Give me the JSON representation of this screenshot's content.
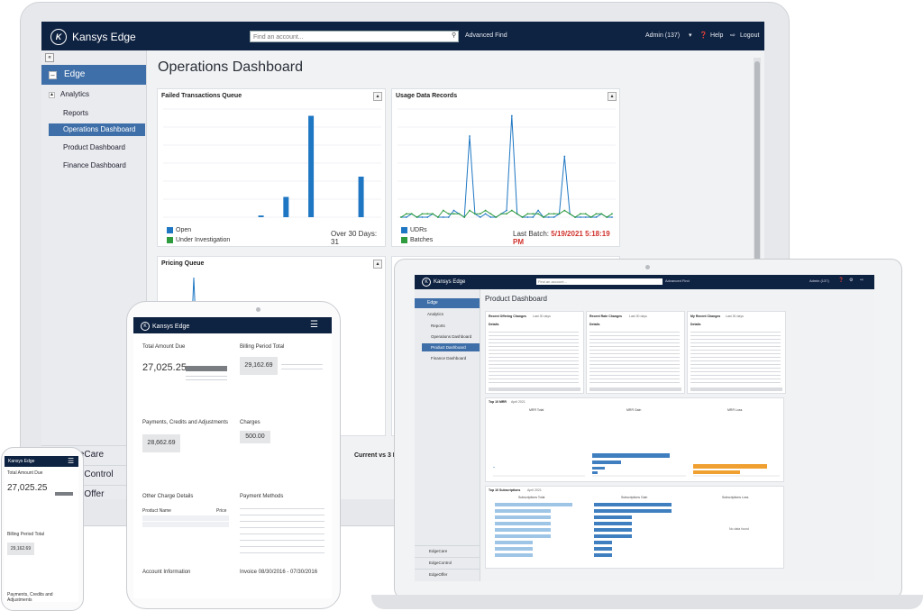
{
  "colors": {
    "navy": "#0e2241",
    "accent": "#3f6fa8",
    "bar_blue": "#1f77c3",
    "green": "#2e9b3f",
    "red": "#d0302a",
    "orange": "#f0a030",
    "light_blue": "#9ec5e6"
  },
  "desktop": {
    "brand": "Kansys Edge",
    "search_placeholder": "Find an account...",
    "advanced_find": "Advanced Find",
    "user": "Admin (137)",
    "help": "Help",
    "logout": "Logout",
    "sidebar": {
      "edge": "Edge",
      "analytics": "Analytics",
      "items": [
        "Reports",
        "Operations Dashboard",
        "Product Dashboard",
        "Finance Dashboard"
      ],
      "bottom": [
        "EdgeCare",
        "EdgeControl",
        "EdgeOffer"
      ]
    },
    "page_title": "Operations Dashboard",
    "panels": {
      "failed": {
        "title": "Failed Transactions Queue",
        "legend": [
          "Open",
          "Under Investigation"
        ],
        "summary": "Over 30 Days: 31"
      },
      "usage": {
        "title": "Usage Data Records",
        "legend": [
          "UDRs",
          "Batches"
        ],
        "last_batch_label": "Last Batch:",
        "last_batch_value": "5/19/2021  5:18:19 PM"
      },
      "pricing": {
        "title": "Pricing Queue"
      },
      "current": {
        "title": "Current vs 3 Mo"
      }
    }
  },
  "chart_data": [
    {
      "type": "bar",
      "title": "Failed Transactions Queue",
      "series": [
        {
          "name": "Open",
          "values": [
            0,
            0,
            0,
            0.5,
            6,
            30,
            0,
            12
          ]
        }
      ]
    },
    {
      "type": "line",
      "title": "Usage Data Records",
      "series": [
        {
          "name": "UDRs",
          "values": [
            0,
            0,
            1,
            0,
            0,
            0,
            1,
            0,
            0,
            0,
            2,
            1,
            0,
            24,
            1,
            0,
            1,
            0,
            0,
            1,
            2,
            30,
            1,
            0,
            0,
            0,
            2,
            0,
            0,
            0,
            1,
            18,
            1,
            0,
            0,
            0,
            0,
            0,
            1,
            0,
            0
          ]
        },
        {
          "name": "Batches",
          "values": [
            0,
            1,
            1,
            0,
            1,
            1,
            1,
            0,
            2,
            1,
            1,
            1,
            0,
            2,
            1,
            1,
            2,
            1,
            0,
            1,
            1,
            2,
            1,
            0,
            1,
            1,
            1,
            0,
            1,
            1,
            1,
            2,
            1,
            0,
            1,
            1,
            0,
            1,
            1,
            0,
            1
          ]
        }
      ]
    }
  ],
  "laptop": {
    "brand": "Kansys Edge",
    "search_placeholder": "Find an account...",
    "advanced_find": "Advanced Find",
    "user": "Admin (137)",
    "sidebar": {
      "edge": "Edge",
      "analytics": "Analytics",
      "items": [
        "Reports",
        "Operations Dashboard",
        "Product Dashboard",
        "Finance Dashboard"
      ],
      "bottom": [
        "EdgeCare",
        "EdgeControl",
        "EdgeOffer"
      ]
    },
    "page_title": "Product Dashboard",
    "cards": [
      {
        "title": "Recent Offering Changes",
        "sub": "Last 30 days",
        "details": "Details"
      },
      {
        "title": "Recent Rate Changes",
        "sub": "Last 30 days",
        "details": "Details"
      },
      {
        "title": "My Recent Changes",
        "sub": "Last 30 days",
        "details": "Details"
      }
    ],
    "mrr_title": "Top 10 MRR",
    "mrr_sub": "April 2021",
    "mrr_cols": [
      "MRR Total",
      "MRR Gain",
      "MRR Loss"
    ],
    "subs_title": "Top 10 Subscriptions",
    "subs_sub": "April 2021",
    "subs_cols": [
      "Subscriptions Total",
      "Subscriptions Gain",
      "Subscriptions Loss"
    ],
    "no_data": "No data found"
  },
  "tablet": {
    "brand": "Kansys Edge",
    "total_amount_due": "Total Amount Due",
    "amount": "27,025.25",
    "billing_period_total": "Billing Period Total",
    "billing_amount": "29,162.69",
    "payments_credits": "Payments, Credits and Adjustments",
    "payments_amount": "28,662.69",
    "charges": "Charges",
    "charges_amount": "500.00",
    "other_charge_details": "Other Charge Details",
    "product_name": "Product Name",
    "price": "Price",
    "payment_methods": "Payment Methods",
    "account_information": "Account Information",
    "invoice": "Invoice 08/30/2016 - 07/30/2016"
  },
  "phone": {
    "brand": "Kansys Edge",
    "total_amount_due": "Total Amount Due",
    "amount": "27,025.25",
    "billing_period_total": "Billing Period Total",
    "billing_amount": "29,162.69",
    "payments_credits": "Payments, Credits and Adjustments"
  }
}
